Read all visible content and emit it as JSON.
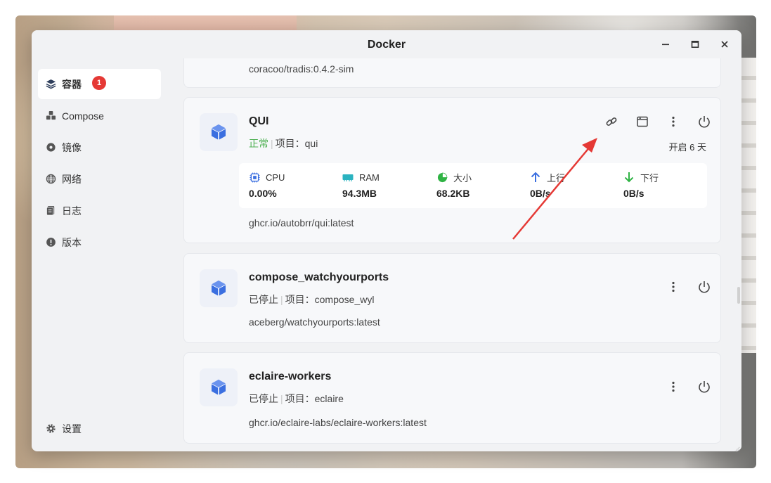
{
  "window": {
    "title": "Docker"
  },
  "sidebar": {
    "items": [
      {
        "label": "容器",
        "icon": "layers-icon",
        "badge": "1",
        "active": true
      },
      {
        "label": "Compose",
        "icon": "cubes-icon"
      },
      {
        "label": "镜像",
        "icon": "disc-icon"
      },
      {
        "label": "网络",
        "icon": "globe-icon"
      },
      {
        "label": "日志",
        "icon": "log-icon"
      },
      {
        "label": "版本",
        "icon": "info-icon"
      }
    ],
    "settings_label": "设置"
  },
  "containers": [
    {
      "image": "coracoo/tradis:0.4.2-sim"
    },
    {
      "name": "QUI",
      "status": "正常",
      "project_label": "项目：",
      "project": "qui",
      "uptime": "开启 6 天",
      "image": "ghcr.io/autobrr/qui:latest",
      "stats": {
        "cpu_label": "CPU",
        "cpu_value": "0.00%",
        "ram_label": "RAM",
        "ram_value": "94.3MB",
        "size_label": "大小",
        "size_value": "68.2KB",
        "up_label": "上行",
        "up_value": "0B/s",
        "down_label": "下行",
        "down_value": "0B/s"
      }
    },
    {
      "name": "compose_watchyourports",
      "status": "已停止",
      "project_label": "项目：",
      "project": "compose_wyl",
      "image": "aceberg/watchyourports:latest"
    },
    {
      "name": "eclaire-workers",
      "status": "已停止",
      "project_label": "项目：",
      "project": "eclaire",
      "image": "ghcr.io/eclaire-labs/eclaire-workers:latest"
    }
  ],
  "colors": {
    "running_dot": "#4caf50",
    "stopped_dot": "#555555",
    "badge": "#e53935",
    "annotation_arrow": "#e53935",
    "logo_blue": "#3b6fe0"
  }
}
